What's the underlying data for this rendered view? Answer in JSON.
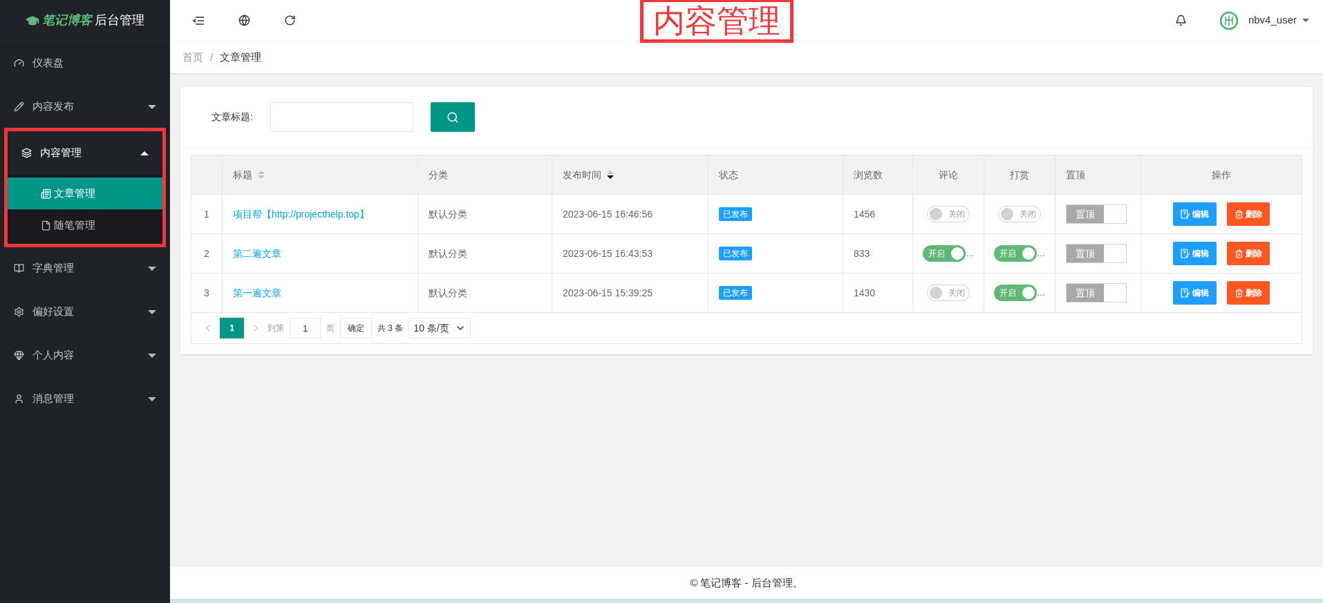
{
  "sidebar": {
    "logo": {
      "brand": "笔记博客",
      "suffix": "后台管理"
    },
    "items": [
      {
        "label": "仪表盘",
        "has_caret": false,
        "expanded": false
      },
      {
        "label": "内容发布",
        "has_caret": true,
        "expanded": false
      },
      {
        "label": "内容管理",
        "has_caret": true,
        "expanded": true,
        "highlighted": true,
        "children": [
          {
            "label": "文章管理",
            "selected": true
          },
          {
            "label": "随笔管理",
            "selected": false
          }
        ]
      },
      {
        "label": "字典管理",
        "has_caret": true,
        "expanded": false
      },
      {
        "label": "偏好设置",
        "has_caret": true,
        "expanded": false
      },
      {
        "label": "个人内容",
        "has_caret": true,
        "expanded": false
      },
      {
        "label": "消息管理",
        "has_caret": true,
        "expanded": false
      }
    ]
  },
  "header": {
    "annotation": "内容管理",
    "user": "nbv4_user"
  },
  "breadcrumb": [
    "首页",
    "文章管理"
  ],
  "breadcrumb_separator": "/",
  "search": {
    "label": "文章标题:"
  },
  "table": {
    "columns": [
      {
        "label": "标题",
        "sorted_desc": false
      },
      {
        "label": "分类"
      },
      {
        "label": "发布时间",
        "sorted_desc": true
      },
      {
        "label": "状态"
      },
      {
        "label": "浏览数"
      },
      {
        "label": "评论"
      },
      {
        "label": "打赏"
      },
      {
        "label": "置顶"
      },
      {
        "label": "操作"
      }
    ],
    "rows": [
      {
        "index": "1",
        "title": "项目帮【http://projecthelp.top】",
        "category": "默认分类",
        "time": "2023-06-15 16:46:56",
        "status": "已发布",
        "views": "1456",
        "comment": {
          "on": false,
          "label": "关闭"
        },
        "reward": {
          "on": false,
          "label": "关闭"
        },
        "top": {
          "on": false,
          "label": "置顶"
        },
        "actions": [
          {
            "kind": "edit",
            "label": "编辑"
          },
          {
            "kind": "delete",
            "label": "删除"
          }
        ]
      },
      {
        "index": "2",
        "title": "第二遍文章",
        "category": "默认分类",
        "time": "2023-06-15 16:43:53",
        "status": "已发布",
        "views": "833",
        "comment": {
          "on": true,
          "label": "开启",
          "ellipsis": "…"
        },
        "reward": {
          "on": true,
          "label": "开启",
          "ellipsis": "…"
        },
        "top": {
          "on": false,
          "label": "置顶"
        },
        "actions": [
          {
            "kind": "edit",
            "label": "编辑"
          },
          {
            "kind": "delete",
            "label": "删除"
          }
        ]
      },
      {
        "index": "3",
        "title": "第一遍文章",
        "category": "默认分类",
        "time": "2023-06-15 15:39:25",
        "status": "已发布",
        "views": "1430",
        "comment": {
          "on": false,
          "label": "关闭"
        },
        "reward": {
          "on": true,
          "label": "开启",
          "ellipsis": "…"
        },
        "top": {
          "on": false,
          "label": "置顶"
        },
        "actions": [
          {
            "kind": "edit",
            "label": "编辑"
          },
          {
            "kind": "delete",
            "label": "删除"
          }
        ]
      }
    ]
  },
  "pagination": {
    "pages": [
      {
        "label": "1",
        "selected": true
      }
    ],
    "goto_label": "到第",
    "goto_value": "1",
    "page_unit": "页",
    "confirm": "确定",
    "total": "共 3 条",
    "page_size": "10 条/页"
  },
  "footer": "© 笔记博客 - 后台管理。"
}
